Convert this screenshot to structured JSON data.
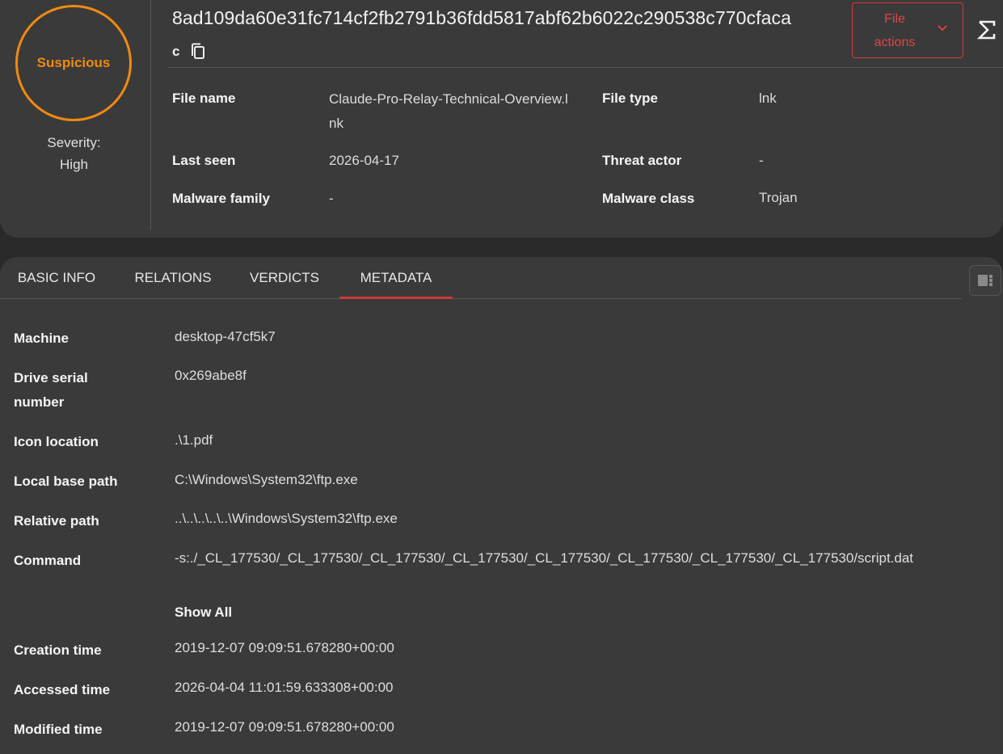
{
  "verdict": {
    "label": "Suspicious",
    "severity_prefix": "Severity:",
    "severity_value": "High",
    "color": "#f08a12"
  },
  "header": {
    "hash": "8ad109da60e31fc714cf2fb2791b36fdd5817abf62b6022c290538c770cfaca",
    "hash_tail": "c",
    "copy_icon": "copy-icon",
    "file_actions_label": "File actions",
    "file_actions_icon": "chevron-down-icon",
    "sigma_icon": "sigma-icon",
    "accent_color": "#d2393b"
  },
  "fields": {
    "file_name_label": "File name",
    "file_name_value": "Claude-Pro-Relay-Technical-Overview.lnk",
    "file_type_label": "File type",
    "file_type_value": "lnk",
    "last_seen_label": "Last seen",
    "last_seen_value": "2026-04-17",
    "threat_actor_label": "Threat actor",
    "threat_actor_value": "-",
    "malware_family_label": "Malware family",
    "malware_family_value": "-",
    "malware_class_label": "Malware class",
    "malware_class_value": "Trojan"
  },
  "tabs": [
    {
      "label": "BASIC INFO",
      "active": false
    },
    {
      "label": "RELATIONS",
      "active": false
    },
    {
      "label": "VERDICTS",
      "active": false
    },
    {
      "label": "METADATA",
      "active": true
    }
  ],
  "metadata": {
    "machine_label": "Machine",
    "machine_value": "desktop-47cf5k7",
    "drive_serial_label": "Drive serial number",
    "drive_serial_value": "0x269abe8f",
    "icon_location_label": "Icon location",
    "icon_location_value": ".\\1.pdf",
    "local_base_path_label": "Local base path",
    "local_base_path_value": "C:\\Windows\\System32\\ftp.exe",
    "relative_path_label": "Relative path",
    "relative_path_value": "..\\..\\..\\..\\..\\Windows\\System32\\ftp.exe",
    "command_label": "Command",
    "command_value": "-s:./_CL_177530/_CL_177530/_CL_177530/_CL_177530/_CL_177530/_CL_177530/_CL_177530/_CL_177530/script.dat",
    "show_all_label": "Show All",
    "creation_time_label": "Creation time",
    "creation_time_value": "2019-12-07 09:09:51.678280+00:00",
    "accessed_time_label": "Accessed time",
    "accessed_time_value": "2026-04-04 11:01:59.633308+00:00",
    "modified_time_label": "Modified time",
    "modified_time_value": "2019-12-07 09:09:51.678280+00:00"
  }
}
